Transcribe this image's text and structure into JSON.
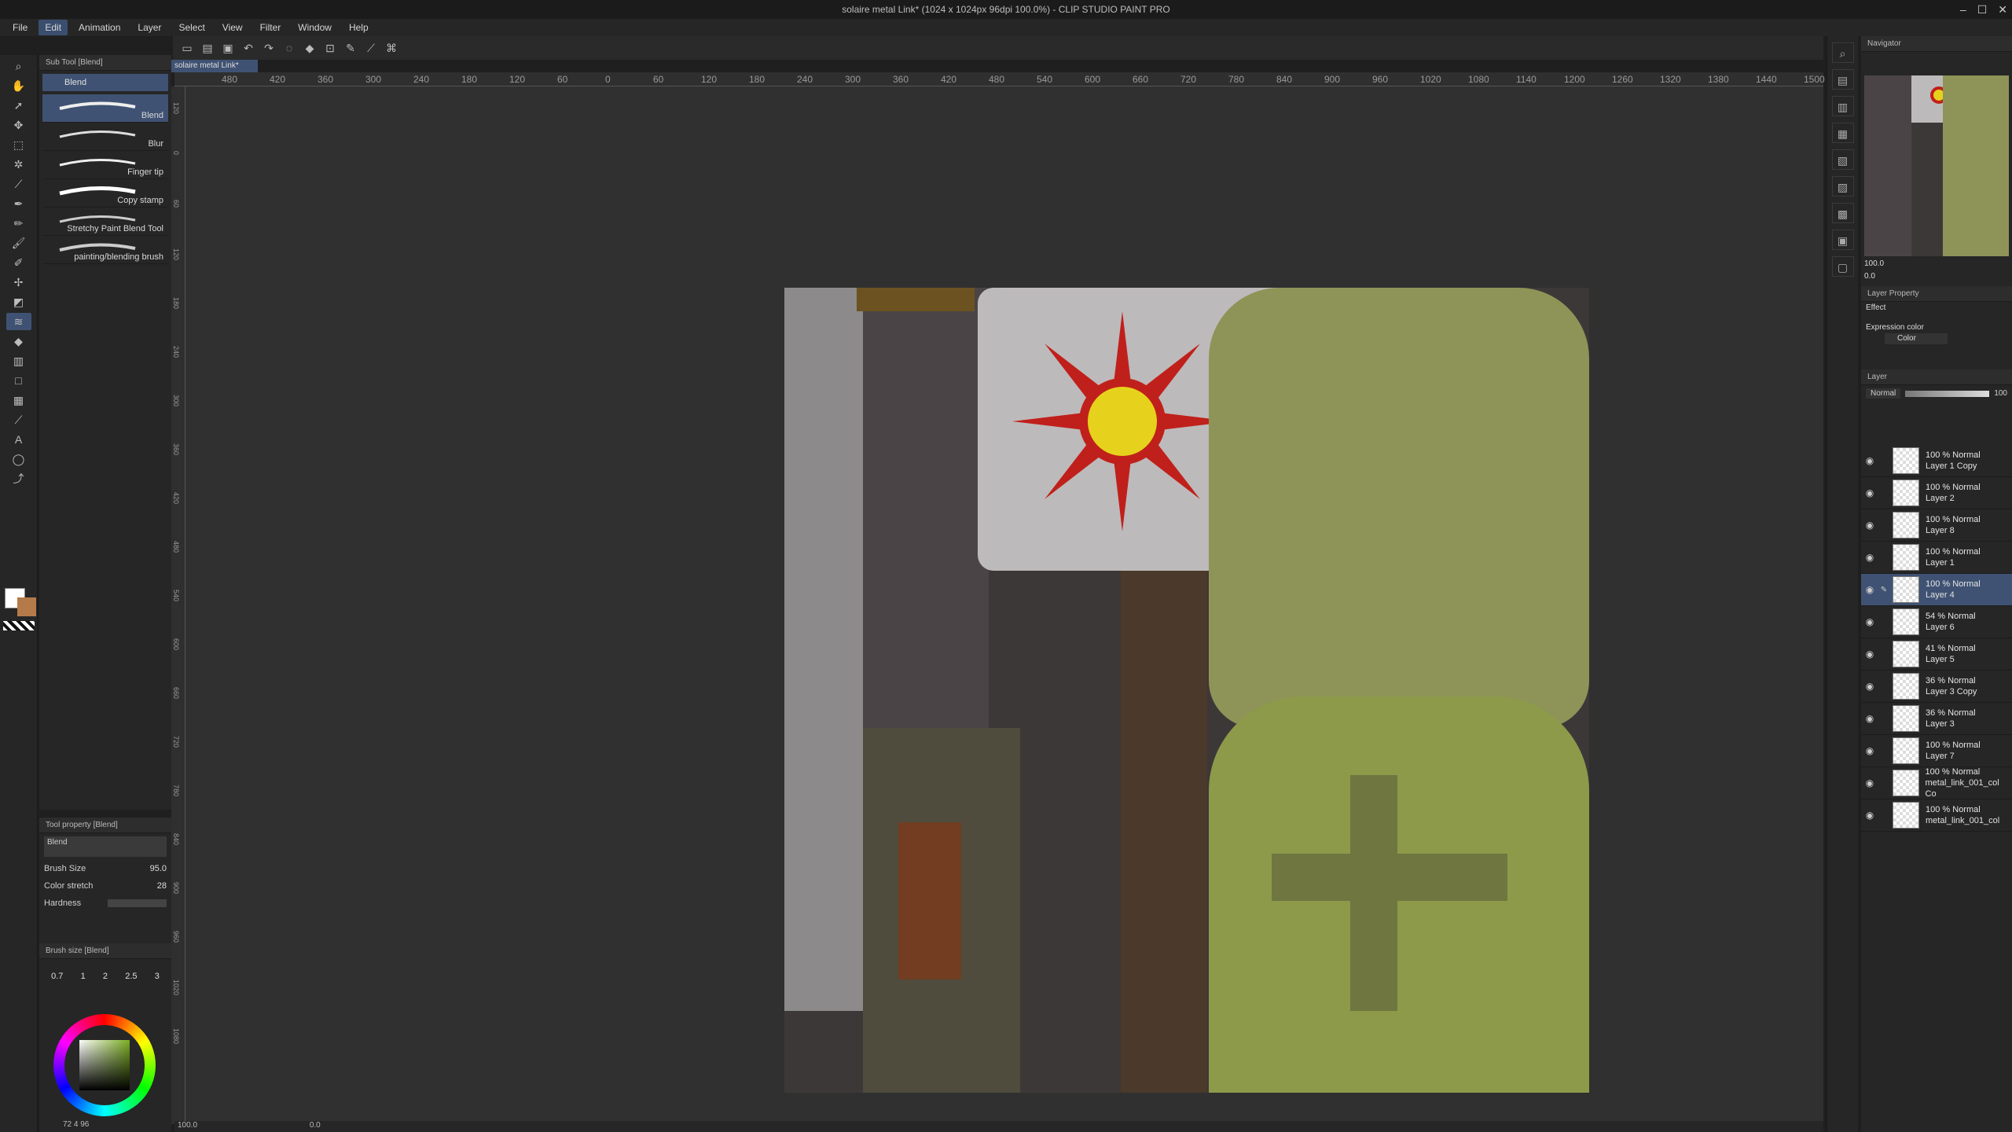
{
  "app": {
    "window_title": "solaire metal Link* (1024 x 1024px 96dpi 100.0%) - CLIP STUDIO PAINT PRO",
    "doc_tab": "solaire metal Link*"
  },
  "menu": [
    "File",
    "Edit",
    "Animation",
    "Layer",
    "Select",
    "View",
    "Filter",
    "Window",
    "Help"
  ],
  "subtool": {
    "title": "Sub Tool [Blend]",
    "selected_tab": "Blend",
    "brushes": [
      {
        "label": "Blend",
        "selected": true
      },
      {
        "label": "Blur",
        "selected": false
      },
      {
        "label": "Finger tip",
        "selected": false
      },
      {
        "label": "Copy stamp",
        "selected": false
      },
      {
        "label": "Stretchy Paint Blend Tool",
        "selected": false
      },
      {
        "label": "painting/blending brush",
        "selected": false
      }
    ]
  },
  "tool_property": {
    "title": "Tool property [Blend]",
    "name": "Blend",
    "brush_size_label": "Brush Size",
    "brush_size_value": "95.0",
    "color_stretch_label": "Color stretch",
    "color_stretch_value": "28",
    "hardness_label": "Hardness"
  },
  "brush_size_panel": {
    "title": "Brush size [Blend]",
    "sizes": [
      "0.7",
      "1",
      "2",
      "2.5",
      "3"
    ]
  },
  "color_bar": {
    "values": "72  4  96"
  },
  "ruler_labels": [
    "480",
    "420",
    "360",
    "300",
    "240",
    "180",
    "120",
    "60",
    "0",
    "60",
    "120",
    "180",
    "240",
    "300",
    "360",
    "420",
    "480",
    "540",
    "600",
    "660",
    "720",
    "780",
    "840",
    "900",
    "960",
    "1020",
    "1080",
    "1140",
    "1200",
    "1260",
    "1320",
    "1380",
    "1440",
    "1500"
  ],
  "ruler_left_labels": [
    "120",
    "0",
    "60",
    "120",
    "180",
    "240",
    "300",
    "360",
    "420",
    "480",
    "540",
    "600",
    "660",
    "720",
    "780",
    "840",
    "900",
    "960",
    "1020",
    "1080"
  ],
  "navigator": {
    "title": "Navigator",
    "zoom": "100.0",
    "rotation": "0.0"
  },
  "layer_property": {
    "title": "Layer Property",
    "effect_label": "Effect",
    "expression_color_label": "Expression color",
    "color_value": "Color"
  },
  "layer_panel": {
    "title": "Layer",
    "blend_mode": "Normal",
    "opacity": "100",
    "layers": [
      {
        "mode": "100 % Normal",
        "name": "Layer 1 Copy",
        "selected": false
      },
      {
        "mode": "100 % Normal",
        "name": "Layer 2",
        "selected": false
      },
      {
        "mode": "100 % Normal",
        "name": "Layer 8",
        "selected": false
      },
      {
        "mode": "100 % Normal",
        "name": "Layer 1",
        "selected": false
      },
      {
        "mode": "100 % Normal",
        "name": "Layer 4",
        "selected": true
      },
      {
        "mode": "54 % Normal",
        "name": "Layer 6",
        "selected": false
      },
      {
        "mode": "41 % Normal",
        "name": "Layer 5",
        "selected": false
      },
      {
        "mode": "36 % Normal",
        "name": "Layer 3 Copy",
        "selected": false
      },
      {
        "mode": "36 % Normal",
        "name": "Layer 3",
        "selected": false
      },
      {
        "mode": "100 % Normal",
        "name": "Layer 7",
        "selected": false
      },
      {
        "mode": "100 % Normal",
        "name": "metal_link_001_col Co",
        "selected": false
      },
      {
        "mode": "100 % Normal",
        "name": "metal_link_001_col",
        "selected": false
      }
    ]
  },
  "status": {
    "zoom": "100.0",
    "rotate": "0.0"
  },
  "colors": {
    "accent": "#3f5273",
    "panel_bg": "#262626",
    "canvas_bg": "#303030"
  }
}
